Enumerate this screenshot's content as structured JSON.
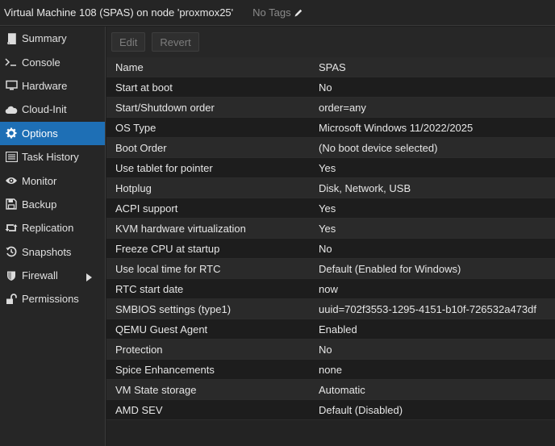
{
  "header": {
    "title": "Virtual Machine 108 (SPAS) on node 'proxmox25'",
    "tags_label": "No Tags"
  },
  "sidebar": {
    "items": [
      {
        "label": "Summary",
        "icon": "book-icon"
      },
      {
        "label": "Console",
        "icon": "terminal-icon"
      },
      {
        "label": "Hardware",
        "icon": "monitor-icon"
      },
      {
        "label": "Cloud-Init",
        "icon": "cloud-icon"
      },
      {
        "label": "Options",
        "icon": "gear-icon",
        "active": true
      },
      {
        "label": "Task History",
        "icon": "list-icon"
      },
      {
        "label": "Monitor",
        "icon": "eye-icon"
      },
      {
        "label": "Backup",
        "icon": "floppy-icon"
      },
      {
        "label": "Replication",
        "icon": "retweet-icon"
      },
      {
        "label": "Snapshots",
        "icon": "history-icon"
      },
      {
        "label": "Firewall",
        "icon": "shield-icon"
      },
      {
        "label": "Permissions",
        "icon": "unlock-icon"
      }
    ]
  },
  "toolbar": {
    "edit_label": "Edit",
    "revert_label": "Revert"
  },
  "options": {
    "rows": [
      {
        "name": "Name",
        "value": "SPAS"
      },
      {
        "name": "Start at boot",
        "value": "No"
      },
      {
        "name": "Start/Shutdown order",
        "value": "order=any"
      },
      {
        "name": "OS Type",
        "value": "Microsoft Windows 11/2022/2025"
      },
      {
        "name": "Boot Order",
        "value": "(No boot device selected)"
      },
      {
        "name": "Use tablet for pointer",
        "value": "Yes"
      },
      {
        "name": "Hotplug",
        "value": "Disk, Network, USB"
      },
      {
        "name": "ACPI support",
        "value": "Yes"
      },
      {
        "name": "KVM hardware virtualization",
        "value": "Yes"
      },
      {
        "name": "Freeze CPU at startup",
        "value": "No"
      },
      {
        "name": "Use local time for RTC",
        "value": "Default (Enabled for Windows)"
      },
      {
        "name": "RTC start date",
        "value": "now"
      },
      {
        "name": "SMBIOS settings (type1)",
        "value": "uuid=702f3553-1295-4151-b10f-726532a473df"
      },
      {
        "name": "QEMU Guest Agent",
        "value": "Enabled"
      },
      {
        "name": "Protection",
        "value": "No"
      },
      {
        "name": "Spice Enhancements",
        "value": "none"
      },
      {
        "name": "VM State storage",
        "value": "Automatic"
      },
      {
        "name": "AMD SEV",
        "value": "Default (Disabled)"
      }
    ]
  },
  "colors": {
    "accent": "#1e6fb5",
    "background": "#1f1f1f"
  }
}
